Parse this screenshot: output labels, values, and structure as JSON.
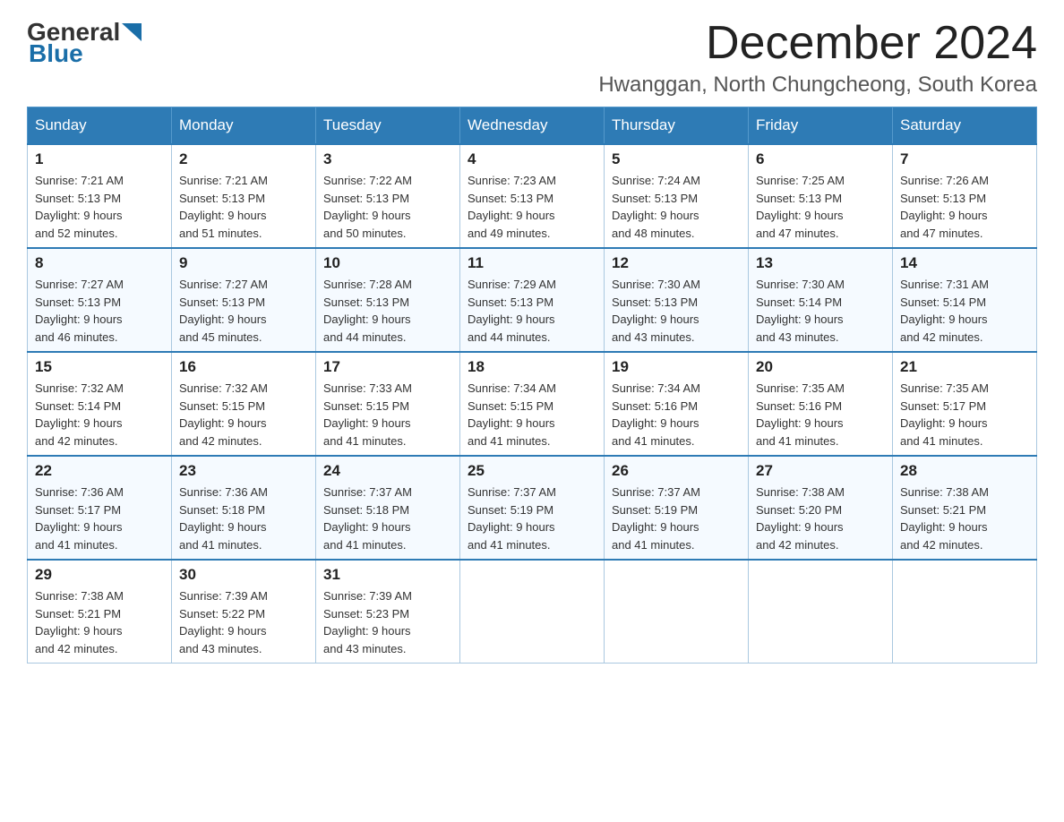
{
  "header": {
    "logo": {
      "general": "General",
      "blue": "Blue"
    },
    "title": "December 2024",
    "location": "Hwanggan, North Chungcheong, South Korea"
  },
  "weekdays": [
    "Sunday",
    "Monday",
    "Tuesday",
    "Wednesday",
    "Thursday",
    "Friday",
    "Saturday"
  ],
  "weeks": [
    [
      {
        "day": "1",
        "sunrise": "7:21 AM",
        "sunset": "5:13 PM",
        "daylight": "9 hours and 52 minutes."
      },
      {
        "day": "2",
        "sunrise": "7:21 AM",
        "sunset": "5:13 PM",
        "daylight": "9 hours and 51 minutes."
      },
      {
        "day": "3",
        "sunrise": "7:22 AM",
        "sunset": "5:13 PM",
        "daylight": "9 hours and 50 minutes."
      },
      {
        "day": "4",
        "sunrise": "7:23 AM",
        "sunset": "5:13 PM",
        "daylight": "9 hours and 49 minutes."
      },
      {
        "day": "5",
        "sunrise": "7:24 AM",
        "sunset": "5:13 PM",
        "daylight": "9 hours and 48 minutes."
      },
      {
        "day": "6",
        "sunrise": "7:25 AM",
        "sunset": "5:13 PM",
        "daylight": "9 hours and 47 minutes."
      },
      {
        "day": "7",
        "sunrise": "7:26 AM",
        "sunset": "5:13 PM",
        "daylight": "9 hours and 47 minutes."
      }
    ],
    [
      {
        "day": "8",
        "sunrise": "7:27 AM",
        "sunset": "5:13 PM",
        "daylight": "9 hours and 46 minutes."
      },
      {
        "day": "9",
        "sunrise": "7:27 AM",
        "sunset": "5:13 PM",
        "daylight": "9 hours and 45 minutes."
      },
      {
        "day": "10",
        "sunrise": "7:28 AM",
        "sunset": "5:13 PM",
        "daylight": "9 hours and 44 minutes."
      },
      {
        "day": "11",
        "sunrise": "7:29 AM",
        "sunset": "5:13 PM",
        "daylight": "9 hours and 44 minutes."
      },
      {
        "day": "12",
        "sunrise": "7:30 AM",
        "sunset": "5:13 PM",
        "daylight": "9 hours and 43 minutes."
      },
      {
        "day": "13",
        "sunrise": "7:30 AM",
        "sunset": "5:14 PM",
        "daylight": "9 hours and 43 minutes."
      },
      {
        "day": "14",
        "sunrise": "7:31 AM",
        "sunset": "5:14 PM",
        "daylight": "9 hours and 42 minutes."
      }
    ],
    [
      {
        "day": "15",
        "sunrise": "7:32 AM",
        "sunset": "5:14 PM",
        "daylight": "9 hours and 42 minutes."
      },
      {
        "day": "16",
        "sunrise": "7:32 AM",
        "sunset": "5:15 PM",
        "daylight": "9 hours and 42 minutes."
      },
      {
        "day": "17",
        "sunrise": "7:33 AM",
        "sunset": "5:15 PM",
        "daylight": "9 hours and 41 minutes."
      },
      {
        "day": "18",
        "sunrise": "7:34 AM",
        "sunset": "5:15 PM",
        "daylight": "9 hours and 41 minutes."
      },
      {
        "day": "19",
        "sunrise": "7:34 AM",
        "sunset": "5:16 PM",
        "daylight": "9 hours and 41 minutes."
      },
      {
        "day": "20",
        "sunrise": "7:35 AM",
        "sunset": "5:16 PM",
        "daylight": "9 hours and 41 minutes."
      },
      {
        "day": "21",
        "sunrise": "7:35 AM",
        "sunset": "5:17 PM",
        "daylight": "9 hours and 41 minutes."
      }
    ],
    [
      {
        "day": "22",
        "sunrise": "7:36 AM",
        "sunset": "5:17 PM",
        "daylight": "9 hours and 41 minutes."
      },
      {
        "day": "23",
        "sunrise": "7:36 AM",
        "sunset": "5:18 PM",
        "daylight": "9 hours and 41 minutes."
      },
      {
        "day": "24",
        "sunrise": "7:37 AM",
        "sunset": "5:18 PM",
        "daylight": "9 hours and 41 minutes."
      },
      {
        "day": "25",
        "sunrise": "7:37 AM",
        "sunset": "5:19 PM",
        "daylight": "9 hours and 41 minutes."
      },
      {
        "day": "26",
        "sunrise": "7:37 AM",
        "sunset": "5:19 PM",
        "daylight": "9 hours and 41 minutes."
      },
      {
        "day": "27",
        "sunrise": "7:38 AM",
        "sunset": "5:20 PM",
        "daylight": "9 hours and 42 minutes."
      },
      {
        "day": "28",
        "sunrise": "7:38 AM",
        "sunset": "5:21 PM",
        "daylight": "9 hours and 42 minutes."
      }
    ],
    [
      {
        "day": "29",
        "sunrise": "7:38 AM",
        "sunset": "5:21 PM",
        "daylight": "9 hours and 42 minutes."
      },
      {
        "day": "30",
        "sunrise": "7:39 AM",
        "sunset": "5:22 PM",
        "daylight": "9 hours and 43 minutes."
      },
      {
        "day": "31",
        "sunrise": "7:39 AM",
        "sunset": "5:23 PM",
        "daylight": "9 hours and 43 minutes."
      },
      null,
      null,
      null,
      null
    ]
  ],
  "labels": {
    "sunrise": "Sunrise:",
    "sunset": "Sunset:",
    "daylight": "Daylight:"
  }
}
